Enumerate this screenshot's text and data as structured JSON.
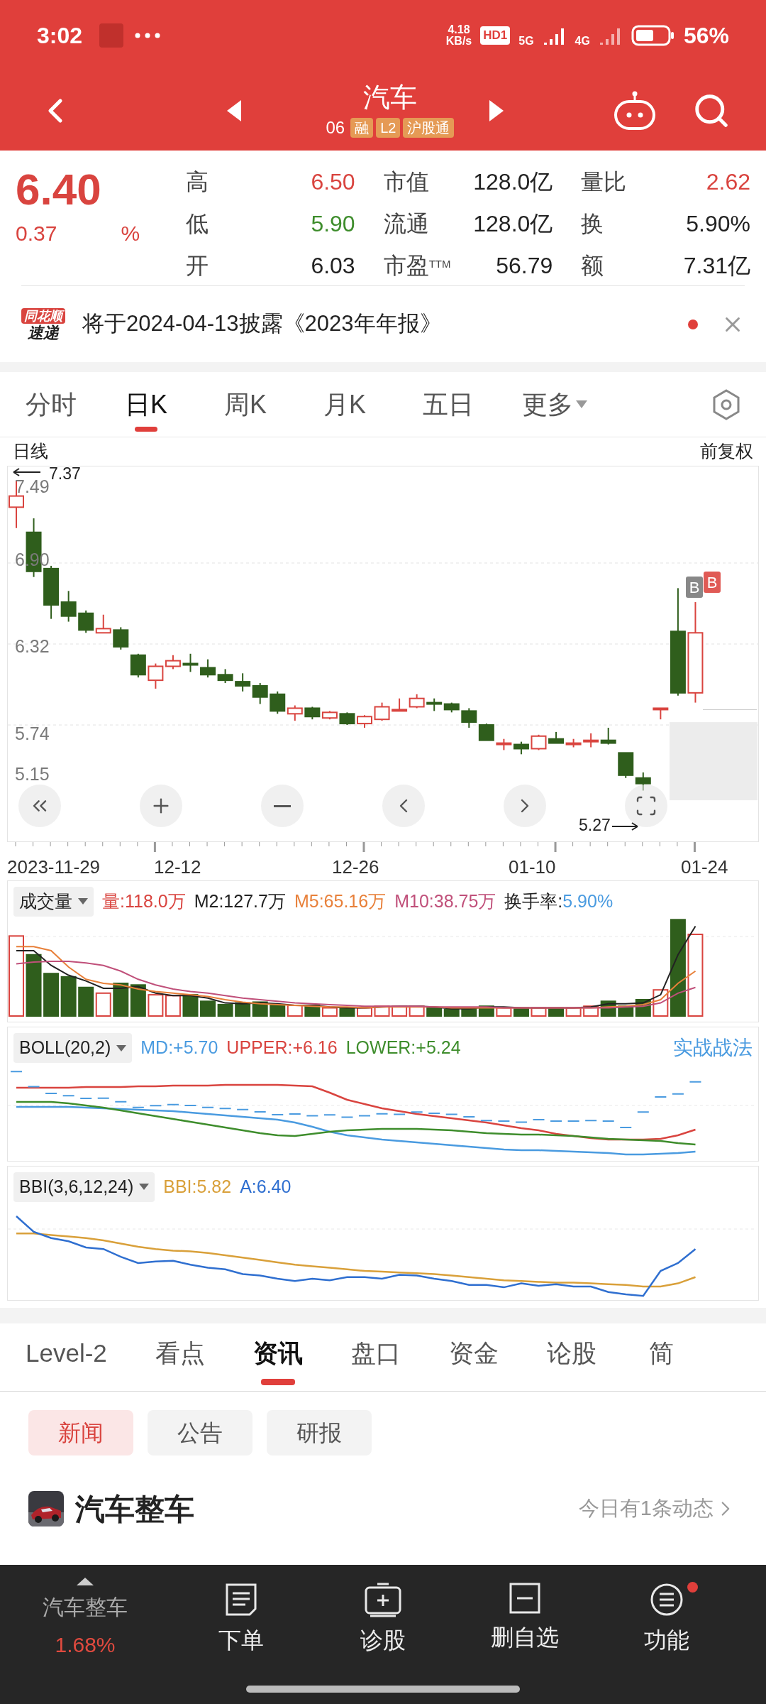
{
  "status_bar": {
    "time": "3:02",
    "speed_value": "4.18",
    "speed_unit": "KB/s",
    "hd": "HD1",
    "net_1": "5G",
    "net_2": "4G",
    "battery": "56%"
  },
  "header": {
    "title": "汽车",
    "code": "06",
    "tags": [
      "融",
      "L2",
      "沪股通"
    ]
  },
  "quote": {
    "price": "6.40",
    "change": "0.37",
    "change_pct": "%"
  },
  "stats": [
    {
      "label": "高",
      "value": "6.50",
      "color": "#d9443f"
    },
    {
      "label": "市值",
      "value": "128.0亿",
      "color": "#222222"
    },
    {
      "label": "量比",
      "value": "2.62",
      "color": "#d9443f"
    },
    {
      "label": "低",
      "value": "5.90",
      "color": "#3e8d2c"
    },
    {
      "label": "流通",
      "value": "128.0亿",
      "color": "#222222"
    },
    {
      "label": "换",
      "value": "5.90%",
      "color": "#222222"
    },
    {
      "label": "开",
      "value": "6.03",
      "color": "#222222"
    },
    {
      "label": "市盈$^{TTM}$",
      "value": "56.79",
      "color": "#222222"
    },
    {
      "label": "额",
      "value": "7.31亿",
      "color": "#222222"
    }
  ],
  "banner": {
    "logo_top": "同花顺",
    "logo_bottom": "速递",
    "text": "将于2024-04-13披露《2023年年报》",
    "unread": true
  },
  "chart_tabs": [
    {
      "label": "分时",
      "selected": false
    },
    {
      "label": "日K",
      "selected": true
    },
    {
      "label": "周K",
      "selected": false
    },
    {
      "label": "月K",
      "selected": false
    },
    {
      "label": "五日",
      "selected": false
    },
    {
      "label": "更多",
      "selected": false,
      "dropdown": true
    }
  ],
  "kline": {
    "period": "日线",
    "adjust": "前复权",
    "yticks": [
      "7.49",
      "6.90",
      "6.32",
      "5.74",
      "5.15"
    ],
    "high_mark": "7.37",
    "low_mark": "5.27",
    "buy_marks": [
      "B",
      "B"
    ],
    "xticks": [
      "2023-11-29",
      "12-12",
      "12-26",
      "01-10",
      "01-24"
    ]
  },
  "volume": {
    "selector": "成交量",
    "items": [
      {
        "text": "量:118.0万",
        "color": "#d9443f"
      },
      {
        "text": "M2:127.7万",
        "color": "#222222"
      },
      {
        "text": "M5:65.16万",
        "color": "#e8803a"
      },
      {
        "text": "M10:38.75万",
        "color": "#c0507a"
      },
      {
        "text": "换手率:",
        "color": "#222222"
      },
      {
        "text": "5.90%",
        "color": "#4a9be0"
      }
    ]
  },
  "boll": {
    "selector": "BOLL(20,2)",
    "items": [
      {
        "text": "MD:+5.70",
        "color": "#4a9be0"
      },
      {
        "text": "UPPER:+6.16",
        "color": "#d9443f"
      },
      {
        "text": "LOWER:+5.24",
        "color": "#3e8d2c"
      }
    ],
    "link": "实战战法"
  },
  "bbi": {
    "selector": "BBI(3,6,12,24)",
    "items": [
      {
        "text": "BBI:5.82",
        "color": "#d9a03a"
      },
      {
        "text": "A:6.40",
        "color": "#2f6fd0"
      }
    ]
  },
  "info_tabs": [
    {
      "label": "Level-2",
      "selected": false
    },
    {
      "label": "看点",
      "selected": false
    },
    {
      "label": "资讯",
      "selected": true
    },
    {
      "label": "盘口",
      "selected": false
    },
    {
      "label": "资金",
      "selected": false
    },
    {
      "label": "论股",
      "selected": false
    },
    {
      "label": "简",
      "selected": false
    }
  ],
  "news_chips": [
    {
      "label": "新闻",
      "selected": true
    },
    {
      "label": "公告",
      "selected": false
    },
    {
      "label": "研报",
      "selected": false
    }
  ],
  "sector": {
    "name": "汽车整车",
    "activity": "今日有1条动态"
  },
  "bottom_bar": {
    "sector": "汽车整车",
    "sector_change": "1.68%",
    "actions": [
      {
        "label": "下单",
        "kind": "order",
        "dot": false
      },
      {
        "label": "诊股",
        "kind": "diagnose",
        "dot": false
      },
      {
        "label": "删自选",
        "kind": "remove",
        "dot": false
      },
      {
        "label": "功能",
        "kind": "menu",
        "dot": true
      }
    ]
  }
}
